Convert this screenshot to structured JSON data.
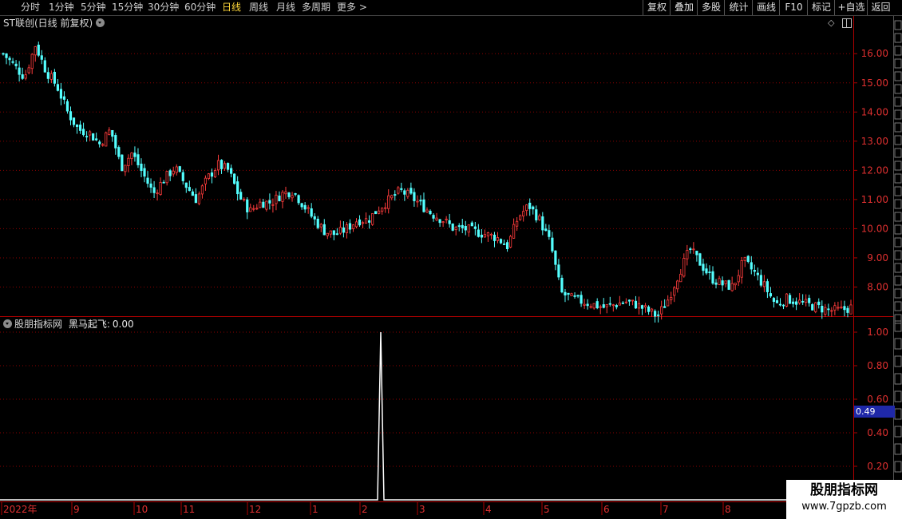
{
  "toolbar": {
    "periods": [
      "分时",
      "1分钟",
      "5分钟",
      "15分钟",
      "30分钟",
      "60分钟",
      "日线",
      "周线",
      "月线",
      "多周期",
      "更多 >"
    ],
    "active_period": "日线",
    "right_buttons": [
      "复权",
      "叠加",
      "多股",
      "统计",
      "画线",
      "F10",
      "标记",
      "+自选",
      "返回"
    ]
  },
  "main_chart": {
    "title": "ST联创(日线 前复权)"
  },
  "indicator": {
    "name": "股朋指标网",
    "series_label": "黑马起飞:",
    "value": "0.00"
  },
  "cursor_value": "0.49",
  "watermark": {
    "line1": "股朋指标网",
    "line2": "www.7gpzb.com"
  },
  "colors": {
    "up": "#ff3c3c",
    "down": "#54ffff",
    "grid": "#8b0000",
    "axis": "#b00000"
  },
  "chart_data": [
    {
      "type": "candlestick",
      "title": "ST联创(日线 前复权)",
      "y_ticks": [
        "16.00",
        "15.00",
        "14.00",
        "13.00",
        "12.00",
        "11.00",
        "10.00",
        "9.00",
        "8.00"
      ],
      "ylim": [
        7.0,
        16.8
      ],
      "x_labels": [
        "2022年",
        "9",
        "10",
        "11",
        "12",
        "1",
        "2",
        "3",
        "4",
        "5",
        "6",
        "7",
        "8"
      ],
      "close_path": [
        16.0,
        15.6,
        15.2,
        16.3,
        15.4,
        14.9,
        14.0,
        13.4,
        13.3,
        12.9,
        13.4,
        12.1,
        12.6,
        11.9,
        11.2,
        11.7,
        12.1,
        11.5,
        11.0,
        11.7,
        12.2,
        12.0,
        11.1,
        10.6,
        10.9,
        10.9,
        11.2,
        11.3,
        10.8,
        10.3,
        9.9,
        9.8,
        10.0,
        10.3,
        10.3,
        10.7,
        11.0,
        11.3,
        11.1,
        10.8,
        10.5,
        10.3,
        10.0,
        10.0,
        9.9,
        9.8,
        9.7,
        9.4,
        10.4,
        10.8,
        10.3,
        9.5,
        7.8,
        7.6,
        7.5,
        7.4,
        7.3,
        7.4,
        7.5,
        7.4,
        7.2,
        7.0,
        7.6,
        8.5,
        9.3,
        8.8,
        8.3,
        8.1,
        8.0,
        8.9,
        8.5,
        8.0,
        7.4,
        7.6,
        7.5,
        7.4,
        7.3,
        7.2,
        7.2,
        7.3
      ]
    },
    {
      "type": "line",
      "series": [
        {
          "name": "黑马起飞",
          "signal_value": 1.0,
          "baseline": 0.0
        }
      ],
      "y_ticks": [
        "1.00",
        "0.80",
        "0.60",
        "0.40",
        "0.20"
      ],
      "ylim": [
        0,
        1.05
      ]
    }
  ]
}
